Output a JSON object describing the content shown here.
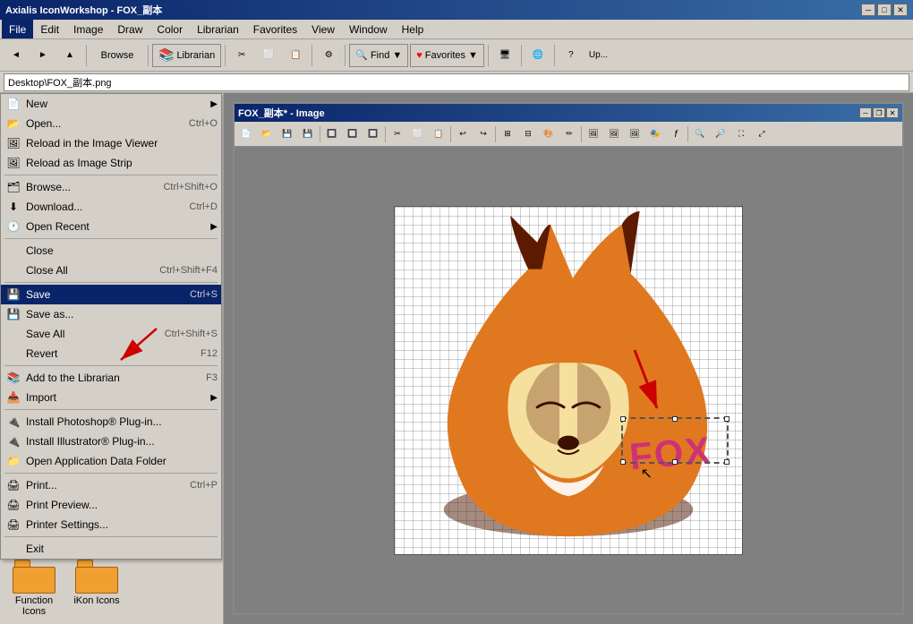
{
  "titleBar": {
    "title": "Axialis IconWorkshop - FOX_副本",
    "minimize": "─",
    "maximize": "□",
    "close": "✕"
  },
  "menuBar": {
    "items": [
      {
        "id": "file",
        "label": "File",
        "active": true
      },
      {
        "id": "edit",
        "label": "Edit"
      },
      {
        "id": "image",
        "label": "Image"
      },
      {
        "id": "draw",
        "label": "Draw"
      },
      {
        "id": "color",
        "label": "Color"
      },
      {
        "id": "librarian",
        "label": "Librarian"
      },
      {
        "id": "favorites",
        "label": "Favorites"
      },
      {
        "id": "view",
        "label": "View"
      },
      {
        "id": "window",
        "label": "Window"
      },
      {
        "id": "help",
        "label": "Help"
      }
    ]
  },
  "toolbar": {
    "backLabel": "◄",
    "forwardLabel": "►",
    "upLabel": "▲",
    "browseLabel": "Browse",
    "librarianLabel": "Librarian",
    "findLabel": "Find",
    "favoritesLabel": "Favorites",
    "monitorLabel": "🖥",
    "globeLabel": "🌐",
    "helpLabel": "?",
    "updateLabel": "Up..."
  },
  "addressBar": {
    "path": "Desktop\\FOX_副本.png"
  },
  "fileMenu": {
    "items": [
      {
        "id": "new",
        "label": "New",
        "shortcut": "",
        "arrow": true,
        "icon": "new-file"
      },
      {
        "id": "open",
        "label": "Open...",
        "shortcut": "Ctrl+O",
        "icon": "open-file"
      },
      {
        "id": "reload-viewer",
        "label": "Reload in the Image Viewer",
        "icon": "reload"
      },
      {
        "id": "reload-strip",
        "label": "Reload as Image Strip",
        "icon": "reload-strip"
      },
      {
        "id": "sep1",
        "separator": true
      },
      {
        "id": "browse",
        "label": "Browse...",
        "shortcut": "Ctrl+Shift+O",
        "icon": "browse"
      },
      {
        "id": "download",
        "label": "Download...",
        "shortcut": "Ctrl+D",
        "icon": "download"
      },
      {
        "id": "open-recent",
        "label": "Open Recent",
        "arrow": true,
        "icon": "recent"
      },
      {
        "id": "sep2",
        "separator": true
      },
      {
        "id": "close",
        "label": "Close",
        "icon": ""
      },
      {
        "id": "close-all",
        "label": "Close All",
        "shortcut": "Ctrl+Shift+F4",
        "icon": ""
      },
      {
        "id": "sep3",
        "separator": true
      },
      {
        "id": "save",
        "label": "Save",
        "shortcut": "Ctrl+S",
        "icon": "save",
        "highlighted": true
      },
      {
        "id": "save-as",
        "label": "Save as...",
        "icon": "save-as"
      },
      {
        "id": "save-all",
        "label": "Save All",
        "shortcut": "Ctrl+Shift+S",
        "icon": ""
      },
      {
        "id": "revert",
        "label": "Revert",
        "shortcut": "F12",
        "icon": ""
      },
      {
        "id": "sep4",
        "separator": true
      },
      {
        "id": "add-librarian",
        "label": "Add to the Librarian",
        "shortcut": "F3",
        "icon": "librarian-add"
      },
      {
        "id": "import",
        "label": "Import",
        "arrow": true,
        "icon": "import"
      },
      {
        "id": "sep5",
        "separator": true
      },
      {
        "id": "install-ps",
        "label": "Install Photoshop® Plug-in...",
        "icon": "plugin"
      },
      {
        "id": "install-ai",
        "label": "Install Illustrator® Plug-in...",
        "icon": "plugin"
      },
      {
        "id": "open-data",
        "label": "Open Application Data Folder",
        "icon": "folder"
      },
      {
        "id": "sep6",
        "separator": true
      },
      {
        "id": "print",
        "label": "Print...",
        "shortcut": "Ctrl+P",
        "icon": "print"
      },
      {
        "id": "print-preview",
        "label": "Print Preview...",
        "icon": "print-preview"
      },
      {
        "id": "printer-settings",
        "label": "Printer Settings...",
        "icon": "printer-settings"
      },
      {
        "id": "sep7",
        "separator": true
      },
      {
        "id": "exit",
        "label": "Exit",
        "icon": ""
      }
    ]
  },
  "innerWindow": {
    "title": "FOX_副本* - Image",
    "minimize": "─",
    "restore": "❐",
    "close": "✕"
  },
  "bottomIcons": [
    {
      "id": "function",
      "label": "Function\nIcons"
    },
    {
      "id": "ikon",
      "label": "iKon Icons"
    }
  ],
  "colors": {
    "titleBarStart": "#0a246a",
    "titleBarEnd": "#3a6ea5",
    "menuBg": "#d4d0c8",
    "activeMenu": "#0a246a",
    "foxOrange": "#e07820",
    "foxDark": "#5c1a00",
    "foxLight": "#f5c070",
    "selectionColor": "#cc0000"
  }
}
